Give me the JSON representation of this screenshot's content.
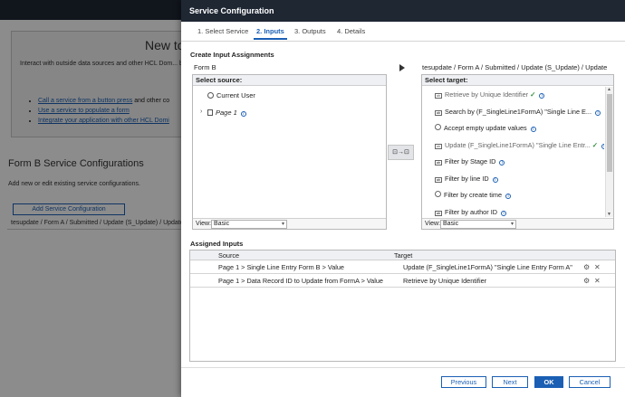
{
  "background": {
    "heading": "New to",
    "intro": "Interact with outside data sources and other HCL Dom... by creating a Service Configuration with input and out... configure events to trigger the service call. Learn how",
    "links": [
      {
        "link": "Call a service from a button press",
        "rest": " and other co"
      },
      {
        "link": "Use a service to populate a form",
        "rest": ""
      },
      {
        "link": "Integrate your application with other HCL Domi",
        "rest": ""
      }
    ],
    "section_title": "Form B Service Configurations",
    "section_desc": "Add new or edit existing service configurations.",
    "add_button": "Add Service Configuration",
    "row": "tesupdate / Form A / Submitted / Update (S_Update) / Update"
  },
  "dialog": {
    "title": "Service Configuration",
    "tabs": [
      {
        "label": "1. Select Service"
      },
      {
        "label": "2. Inputs"
      },
      {
        "label": "3. Outputs"
      },
      {
        "label": "4. Details"
      }
    ],
    "active_tab": 1,
    "create_title": "Create Input Assignments",
    "form_name": "Form B",
    "target_path": "tesupdate / Form A / Submitted / Update (S_Update) / Update",
    "source_box": {
      "header": "Select source:",
      "items": [
        "Current User",
        "Page 1"
      ],
      "view_label": "View:",
      "view_value": "Basic"
    },
    "transfer_label": "⊡→⊡",
    "target_box": {
      "header": "Select target:",
      "items": [
        "Retrieve by Unique Identifier",
        "Search by (F_SingleLine1FormA) \"Single Line E...",
        "Accept empty update values",
        "Update (F_SingleLine1FormA) \"Single Line Entr...",
        "Filter by Stage ID",
        "Filter by line ID",
        "Filter by create time",
        "Filter by author ID"
      ],
      "view_label": "View:",
      "view_value": "Basic"
    },
    "assigned_title": "Assigned Inputs",
    "assigned": {
      "col_source": "Source",
      "col_target": "Target",
      "rows": [
        {
          "source": "Page 1 > Single Line Entry Form B > Value",
          "target": "Update (F_SingleLine1FormA) \"Single Line Entry Form A\""
        },
        {
          "source": "Page 1 > Data Record ID to Update from FormA > Value",
          "target": "Retrieve by Unique Identifier"
        }
      ]
    },
    "buttons": {
      "previous": "Previous",
      "next": "Next",
      "ok": "OK",
      "cancel": "Cancel"
    }
  },
  "colors": {
    "header_bg": "#1f2733",
    "accent": "#1a5fb4",
    "check": "#2e8b3a"
  }
}
